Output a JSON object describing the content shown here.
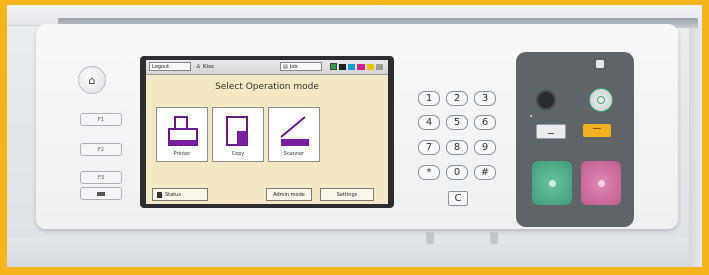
{
  "colors": {
    "background": "#f3b41c",
    "lcd_background": "#f3e7c4",
    "accent_purple": "#7a1fa2",
    "start_color": "#4fae8a",
    "stop_color": "#d46a9c",
    "energy_saver": "#3fa56a",
    "amber_indicator": "#f0b020"
  },
  "left_panel": {
    "home_icon": "home-icon",
    "function_keys": [
      "F1",
      "F2",
      "F3",
      ""
    ]
  },
  "status_bar": {
    "logout": "Logout",
    "user": "Kiss",
    "job": "Job",
    "icons": [
      "wifi-icon",
      "toner-icon"
    ]
  },
  "screen": {
    "title": "Select Operation mode",
    "modes": [
      {
        "label": "Printer",
        "icon": "printer-icon"
      },
      {
        "label": "Copy",
        "icon": "copy-icon"
      },
      {
        "label": "Scanner",
        "icon": "scanner-icon"
      }
    ],
    "status_button": "Status",
    "admin_button": "Admin mode",
    "settings_button": "Settings"
  },
  "keypad": {
    "rows": [
      [
        "1",
        "2",
        "3"
      ],
      [
        "4",
        "5",
        "6"
      ],
      [
        "7",
        "8",
        "9"
      ],
      [
        "*",
        "0",
        "#"
      ]
    ],
    "clear": "C"
  },
  "right_module": {
    "power_icon": "power-icon",
    "energy_saver_icon": "energy-saver-icon",
    "reset_icon": "reset-icon",
    "start_icon": "start-icon",
    "stop_icon": "stop-icon"
  }
}
